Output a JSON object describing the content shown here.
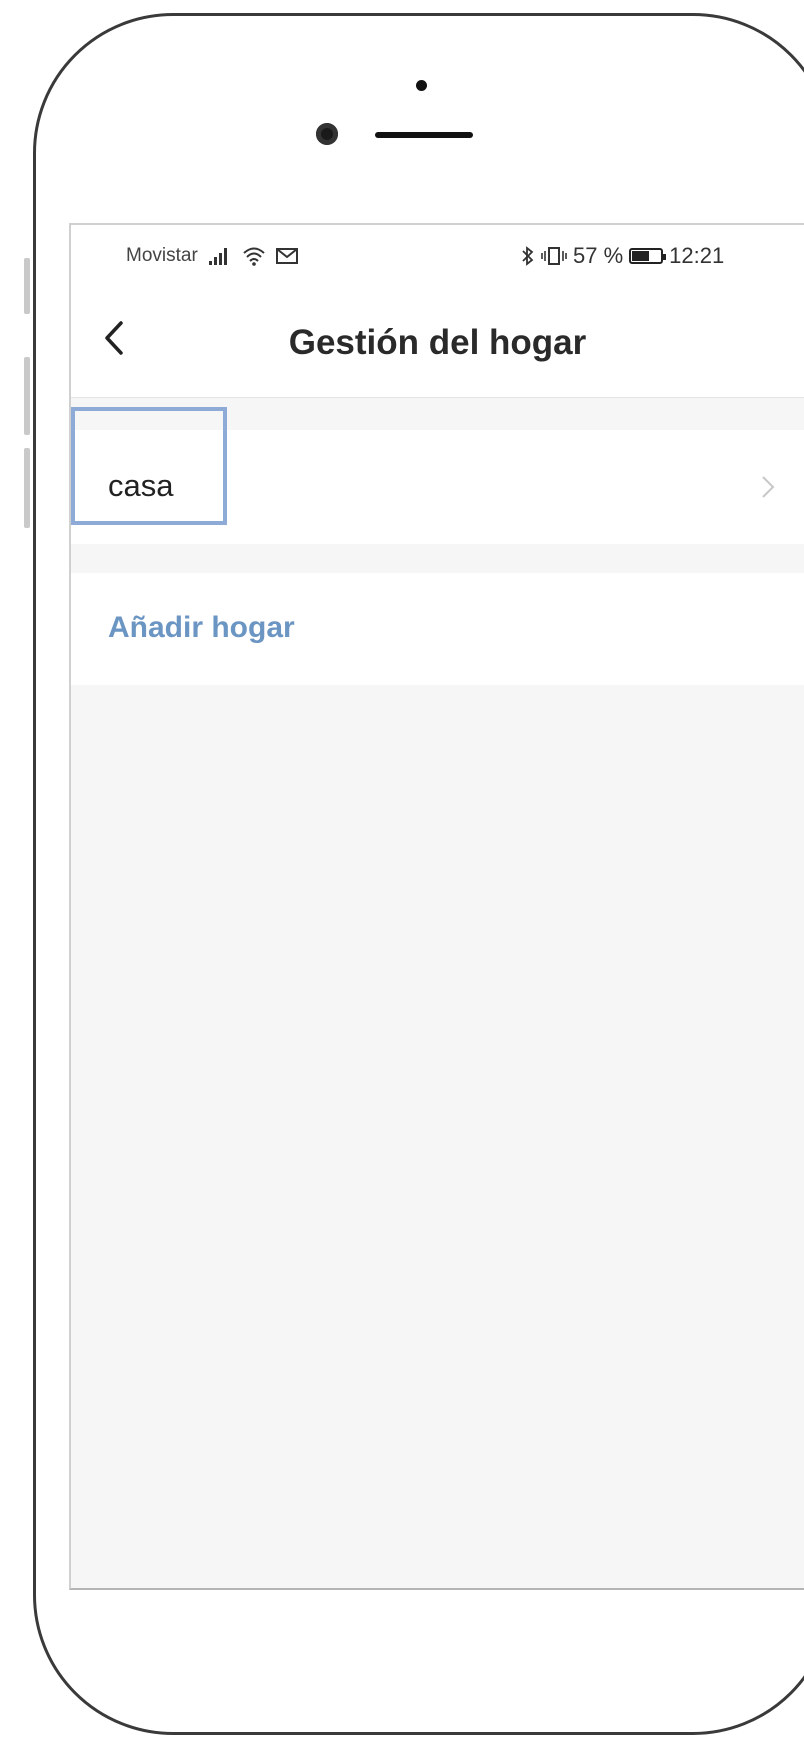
{
  "status_bar": {
    "carrier": "Movistar",
    "battery_percent": "57 %",
    "battery_level": 0.57,
    "time": "12:21"
  },
  "header": {
    "title": "Gestión del hogar"
  },
  "homes": [
    {
      "name": "casa"
    }
  ],
  "actions": {
    "add_home": "Añadir hogar"
  },
  "colors": {
    "accent": "#6b95c2",
    "highlight": "#8eaad7",
    "background": "#f6f6f6"
  },
  "icons": [
    "back-arrow-icon",
    "chevron-right-icon",
    "signal-icon",
    "wifi-icon",
    "mail-icon",
    "bluetooth-icon",
    "vibrate-icon",
    "battery-icon"
  ]
}
